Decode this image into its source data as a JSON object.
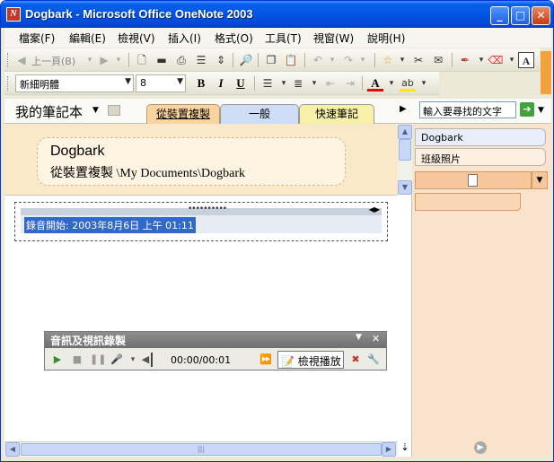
{
  "window": {
    "title": "Dogbark - Microsoft Office OneNote 2003",
    "app_icon_letter": "N"
  },
  "menubar": {
    "items": [
      "檔案(F)",
      "編輯(E)",
      "檢視(V)",
      "插入(I)",
      "格式(O)",
      "工具(T)",
      "視窗(W)",
      "說明(H)"
    ]
  },
  "standard_toolbar": {
    "back_label": "上一頁(B)"
  },
  "format_toolbar": {
    "font_name": "新細明體",
    "font_size": "8",
    "bold_label": "B",
    "italic_label": "I",
    "underline_label": "U",
    "font_color_label": "A",
    "highlight_label": "ab"
  },
  "notebook": {
    "title": "我的筆記本",
    "tabs": [
      {
        "label": "從裝置複製"
      },
      {
        "label": "一般"
      },
      {
        "label": "快速筆記"
      }
    ],
    "search_placeholder": "輸入要尋找的文字"
  },
  "page": {
    "title": "Dogbark",
    "path": "從裝置複製 \\My Documents\\Dogbark",
    "note_text": "錄音開始: 2003年8月6日 上午 01:11"
  },
  "av_toolbar": {
    "title": "音訊及視訊錄製",
    "time": "00:00/00:01",
    "play_label": "檢視播放"
  },
  "page_panel": {
    "pages": [
      {
        "label": "Dogbark"
      },
      {
        "label": "班級照片"
      }
    ]
  },
  "colors": {
    "title_bar": "#0055e5",
    "section_tab_active": "#f9d4a0",
    "section_tab_general": "#cfdcf5",
    "section_tab_quick": "#f7f0a8",
    "page_header": "#fbe8c8",
    "selection": "#3169c6"
  }
}
